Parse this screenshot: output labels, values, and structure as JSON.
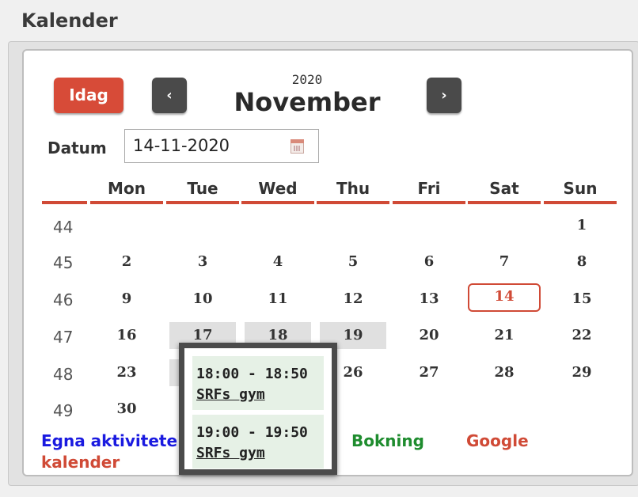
{
  "page": {
    "title": "Kalender"
  },
  "toolbar": {
    "today_label": "Idag",
    "prev_label": "‹",
    "next_label": "›",
    "year": "2020",
    "month": "November"
  },
  "datum": {
    "label": "Datum",
    "value": "14-11-2020"
  },
  "weekdays": [
    "Mon",
    "Tue",
    "Wed",
    "Thu",
    "Fri",
    "Sat",
    "Sun"
  ],
  "weeks": [
    {
      "week": "44",
      "days": [
        "",
        "",
        "",
        "",
        "",
        "",
        "1"
      ]
    },
    {
      "week": "45",
      "days": [
        "2",
        "3",
        "4",
        "5",
        "6",
        "7",
        "8"
      ]
    },
    {
      "week": "46",
      "days": [
        "9",
        "10",
        "11",
        "12",
        "13",
        "14",
        "15"
      ]
    },
    {
      "week": "47",
      "days": [
        "16",
        "17",
        "18",
        "19",
        "20",
        "21",
        "22"
      ]
    },
    {
      "week": "48",
      "days": [
        "23",
        "",
        "",
        "26",
        "27",
        "28",
        "29"
      ]
    },
    {
      "week": "49",
      "days": [
        "30",
        "",
        "",
        "",
        "",
        "",
        ""
      ]
    }
  ],
  "selected_day": "14",
  "legend": {
    "own_activities": "Egna aktivitete",
    "calendar": "kalender",
    "booking": "Bokning",
    "google": "Google"
  },
  "popup": {
    "slots": [
      {
        "time": "18:00 - 18:50",
        "place": "SRFs gym"
      },
      {
        "time": "19:00 - 19:50",
        "place": "SRFs gym"
      }
    ]
  },
  "colors": {
    "accent": "#d04a36",
    "today_button": "#d74b38",
    "nav_button": "#4a4a4a",
    "own_activities": "#1a1ae0",
    "booking": "#1e8c2e",
    "google": "#d04a36",
    "slot_bg": "#e6f1e6"
  }
}
